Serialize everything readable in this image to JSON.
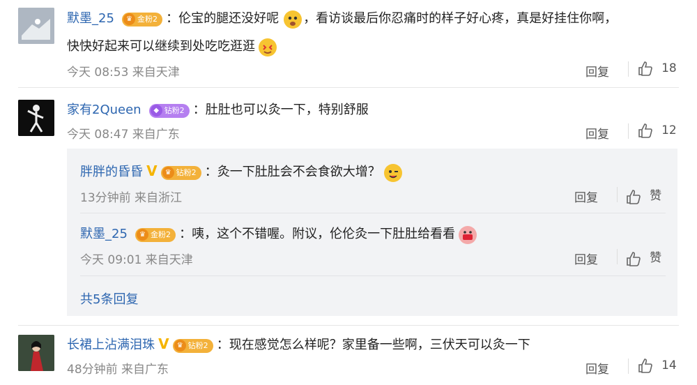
{
  "comments": [
    {
      "username": "默墨_25",
      "badge": "金粉2",
      "text_line1": "：伦宝的腿还没好呢",
      "text_line1b": "，看访谈最后你忍痛时的样子好心疼，真是好挂住你啊，",
      "text_line2": "快快好起来可以继续到处吃吃逛逛",
      "time": "今天 08:53 来自天津",
      "reply_label": "回复",
      "likes": "18"
    },
    {
      "username": "家有2Queen",
      "badge": "钻粉2",
      "text": "：肚肚也可以灸一下，特别舒服",
      "time": "今天 08:47 来自广东",
      "reply_label": "回复",
      "likes": "12"
    },
    {
      "username": "长裙上沾满泪珠",
      "badge": "钻粉2",
      "text": "：现在感觉怎么样呢？家里备一些啊，三伏天可以灸一下",
      "time": "48分钟前 来自广东",
      "reply_label": "回复",
      "likes": "14"
    }
  ],
  "sub_replies": [
    {
      "username": "胖胖的昏昏",
      "badge": "钻粉2",
      "text": "：灸一下肚肚会不会食欲大增？",
      "time": "13分钟前 来自浙江",
      "reply_label": "回复",
      "like_label": "赞"
    },
    {
      "username": "默墨_25",
      "badge": "金粉2",
      "text": "：咦，这个不错喔。附议，伦伦灸一下肚肚给看看",
      "time": "今天 09:01 来自天津",
      "reply_label": "回复",
      "like_label": "赞"
    }
  ],
  "more_replies": "共5条回复",
  "colors": {
    "username": "#2d66b0",
    "gold_badge": "#f3b13a",
    "diamond_badge": "#b57ff0",
    "sub_bg": "#f2f3f5"
  }
}
